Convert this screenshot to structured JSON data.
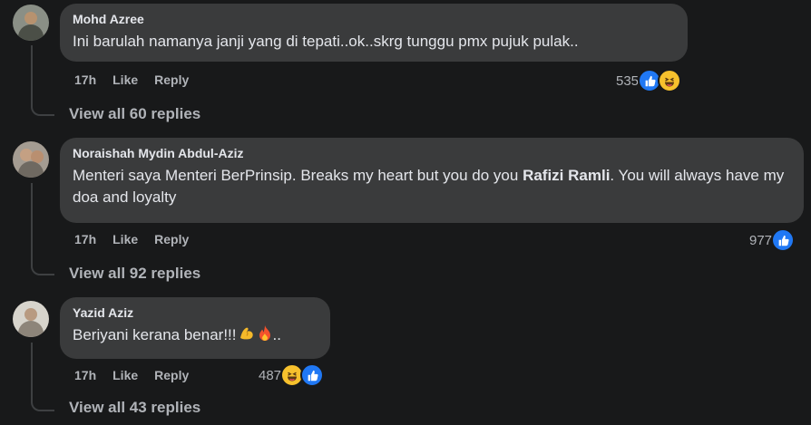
{
  "comments": [
    {
      "author": "Mohd Azree",
      "text": "Ini barulah namanya janji yang di tepati..ok..skrg tunggu pmx pujuk pulak..",
      "time": "17h",
      "like_label": "Like",
      "reply_label": "Reply",
      "reaction_count": "535",
      "reactions": [
        "like-icon",
        "haha-icon"
      ],
      "view_replies": "View all 60 replies"
    },
    {
      "author": "Noraishah Mydin Abdul-Aziz",
      "text_before": "Menteri saya Menteri BerPrinsip. Breaks my heart but you do you ",
      "mention": "Rafizi Ramli",
      "text_after": ". You will always have my doa and loyalty",
      "time": "17h",
      "like_label": "Like",
      "reply_label": "Reply",
      "reaction_count": "977",
      "reactions": [
        "like-icon"
      ],
      "view_replies": "View all 92 replies"
    },
    {
      "author": "Yazid Aziz",
      "text": "Beriyani kerana benar!!!",
      "text_suffix": "..",
      "emojis": [
        "flexed-biceps-icon",
        "fire-icon"
      ],
      "time": "17h",
      "like_label": "Like",
      "reply_label": "Reply",
      "reaction_count": "487",
      "reactions": [
        "haha-icon",
        "like-icon"
      ],
      "view_replies": "View all 43 replies"
    }
  ],
  "colors": {
    "background": "#18191a",
    "bubble": "#3a3b3c",
    "primary_text": "#e4e6eb",
    "secondary_text": "#b0b3b8",
    "like_blue": "#2078f4",
    "haha_yellow": "#f7c12d"
  }
}
